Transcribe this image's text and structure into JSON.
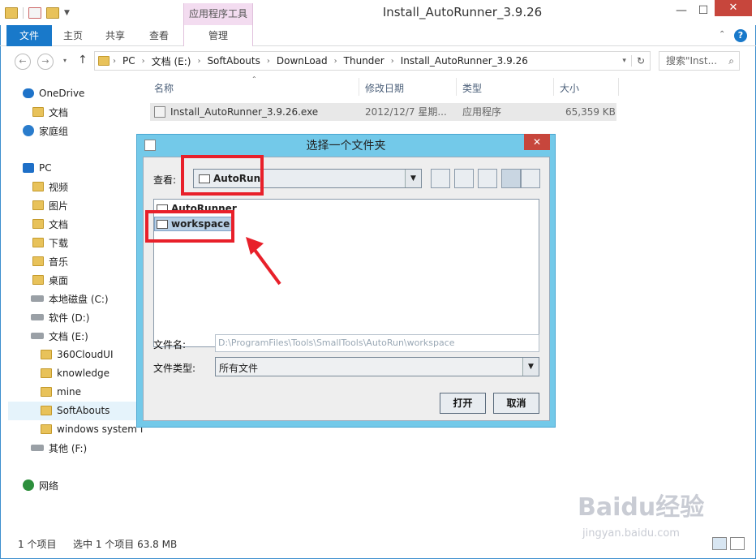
{
  "window": {
    "title": "Install_AutoRunner_3.9.26",
    "context_tab": "应用程序工具",
    "minimize": "—",
    "maximize": "☐",
    "close": "✕"
  },
  "ribbon": {
    "tabs": [
      "文件",
      "主页",
      "共享",
      "查看",
      "管理"
    ],
    "collapse_icon": "chevron-up-icon",
    "help_icon": "?"
  },
  "address": {
    "back": "←",
    "forward": "→",
    "up": "↑",
    "crumbs": [
      "PC",
      "文档 (E:)",
      "SoftAbouts",
      "DownLoad",
      "Thunder",
      "Install_AutoRunner_3.9.26"
    ],
    "refresh": "↻",
    "search_placeholder": "搜索\"Inst..."
  },
  "nav": {
    "items": [
      {
        "label": "OneDrive",
        "icon": "cloud-icon"
      },
      {
        "label": "文档",
        "icon": "folder-icon"
      },
      {
        "label": "家庭组",
        "icon": "homegroup-icon"
      },
      {
        "label": "PC",
        "icon": "pc-icon"
      },
      {
        "label": "视频",
        "icon": "folder-icon"
      },
      {
        "label": "图片",
        "icon": "folder-icon"
      },
      {
        "label": "文档",
        "icon": "folder-icon"
      },
      {
        "label": "下载",
        "icon": "folder-icon"
      },
      {
        "label": "音乐",
        "icon": "folder-icon"
      },
      {
        "label": "桌面",
        "icon": "folder-icon"
      },
      {
        "label": "本地磁盘 (C:)",
        "icon": "drive-icon"
      },
      {
        "label": "软件 (D:)",
        "icon": "drive-icon"
      },
      {
        "label": "文档 (E:)",
        "icon": "drive-icon"
      },
      {
        "label": "360CloudUI",
        "icon": "folder-icon"
      },
      {
        "label": "knowledge",
        "icon": "folder-icon"
      },
      {
        "label": "mine",
        "icon": "folder-icon"
      },
      {
        "label": "SoftAbouts",
        "icon": "folder-icon"
      },
      {
        "label": "windows system f",
        "icon": "folder-icon"
      },
      {
        "label": "其他 (F:)",
        "icon": "drive-icon"
      },
      {
        "label": "网络",
        "icon": "network-icon"
      }
    ]
  },
  "filelist": {
    "headers": [
      "名称",
      "修改日期",
      "类型",
      "大小"
    ],
    "rows": [
      {
        "name": "Install_AutoRunner_3.9.26.exe",
        "date": "2012/12/7 星期...",
        "type": "应用程序",
        "size": "65,359 KB"
      }
    ]
  },
  "status": {
    "count": "1 个项目",
    "selected": "选中 1 个项目 63.8 MB"
  },
  "dialog": {
    "title": "选择一个文件夹",
    "close": "✕",
    "lookin_label": "查看:",
    "lookin_value": "AutoRun",
    "folders": [
      "AutoRunner",
      "workspace"
    ],
    "filename_label": "文件名:",
    "filename_value": "D:\\ProgramFiles\\Tools\\SmallTools\\AutoRun\\workspace",
    "filetype_label": "文件类型:",
    "filetype_value": "所有文件",
    "open_button": "打开",
    "cancel_button": "取消"
  },
  "watermark": {
    "main": "Baidu经验",
    "sub": "jingyan.baidu.com"
  },
  "colors": {
    "accent": "#1979ca",
    "dialog_frame": "#73c9e9",
    "highlight_box": "#e8202a",
    "context_tab": "#f3dcf0"
  }
}
